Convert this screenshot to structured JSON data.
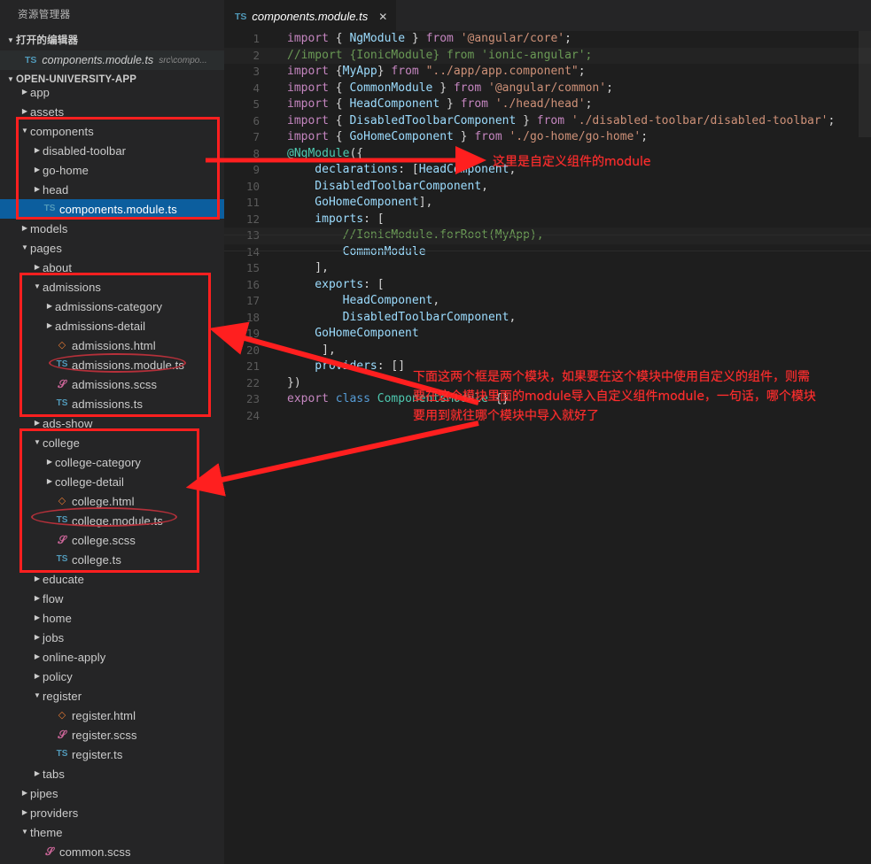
{
  "sidebar": {
    "title": "资源管理器",
    "open_editors": {
      "label": "打开的编辑器",
      "items": [
        {
          "icon": "TS",
          "name": "components.module.ts",
          "path": "src\\compo..."
        }
      ]
    },
    "project": {
      "label": "OPEN-UNIVERSITY-APP"
    },
    "tree": [
      {
        "depth": 1,
        "twisty": "right",
        "icon": "",
        "label": "app",
        "selected": false,
        "clipped": true
      },
      {
        "depth": 1,
        "twisty": "right",
        "icon": "",
        "label": "assets",
        "selected": false
      },
      {
        "depth": 1,
        "twisty": "down",
        "icon": "",
        "label": "components",
        "selected": false
      },
      {
        "depth": 2,
        "twisty": "right",
        "icon": "",
        "label": "disabled-toolbar",
        "selected": false
      },
      {
        "depth": 2,
        "twisty": "right",
        "icon": "",
        "label": "go-home",
        "selected": false
      },
      {
        "depth": 2,
        "twisty": "right",
        "icon": "",
        "label": "head",
        "selected": false
      },
      {
        "depth": 2,
        "twisty": "none",
        "icon": "TS",
        "label": "components.module.ts",
        "selected": true
      },
      {
        "depth": 1,
        "twisty": "right",
        "icon": "",
        "label": "models",
        "selected": false
      },
      {
        "depth": 1,
        "twisty": "down",
        "icon": "",
        "label": "pages",
        "selected": false
      },
      {
        "depth": 2,
        "twisty": "right",
        "icon": "",
        "label": "about",
        "selected": false
      },
      {
        "depth": 2,
        "twisty": "down",
        "icon": "",
        "label": "admissions",
        "selected": false
      },
      {
        "depth": 3,
        "twisty": "right",
        "icon": "",
        "label": "admissions-category",
        "selected": false
      },
      {
        "depth": 3,
        "twisty": "right",
        "icon": "",
        "label": "admissions-detail",
        "selected": false
      },
      {
        "depth": 3,
        "twisty": "none",
        "icon": "HTML",
        "label": "admissions.html",
        "selected": false
      },
      {
        "depth": 3,
        "twisty": "none",
        "icon": "TS",
        "label": "admissions.module.ts",
        "selected": false
      },
      {
        "depth": 3,
        "twisty": "none",
        "icon": "SCSS",
        "label": "admissions.scss",
        "selected": false
      },
      {
        "depth": 3,
        "twisty": "none",
        "icon": "TS",
        "label": "admissions.ts",
        "selected": false
      },
      {
        "depth": 2,
        "twisty": "right",
        "icon": "",
        "label": "ads-show",
        "selected": false
      },
      {
        "depth": 2,
        "twisty": "down",
        "icon": "",
        "label": "college",
        "selected": false
      },
      {
        "depth": 3,
        "twisty": "right",
        "icon": "",
        "label": "college-category",
        "selected": false
      },
      {
        "depth": 3,
        "twisty": "right",
        "icon": "",
        "label": "college-detail",
        "selected": false
      },
      {
        "depth": 3,
        "twisty": "none",
        "icon": "HTML",
        "label": "college.html",
        "selected": false
      },
      {
        "depth": 3,
        "twisty": "none",
        "icon": "TS",
        "label": "college.module.ts",
        "selected": false
      },
      {
        "depth": 3,
        "twisty": "none",
        "icon": "SCSS",
        "label": "college.scss",
        "selected": false
      },
      {
        "depth": 3,
        "twisty": "none",
        "icon": "TS",
        "label": "college.ts",
        "selected": false
      },
      {
        "depth": 2,
        "twisty": "right",
        "icon": "",
        "label": "educate",
        "selected": false
      },
      {
        "depth": 2,
        "twisty": "right",
        "icon": "",
        "label": "flow",
        "selected": false
      },
      {
        "depth": 2,
        "twisty": "right",
        "icon": "",
        "label": "home",
        "selected": false
      },
      {
        "depth": 2,
        "twisty": "right",
        "icon": "",
        "label": "jobs",
        "selected": false
      },
      {
        "depth": 2,
        "twisty": "right",
        "icon": "",
        "label": "online-apply",
        "selected": false
      },
      {
        "depth": 2,
        "twisty": "right",
        "icon": "",
        "label": "policy",
        "selected": false
      },
      {
        "depth": 2,
        "twisty": "down",
        "icon": "",
        "label": "register",
        "selected": false
      },
      {
        "depth": 3,
        "twisty": "none",
        "icon": "HTML",
        "label": "register.html",
        "selected": false
      },
      {
        "depth": 3,
        "twisty": "none",
        "icon": "SCSS",
        "label": "register.scss",
        "selected": false
      },
      {
        "depth": 3,
        "twisty": "none",
        "icon": "TS",
        "label": "register.ts",
        "selected": false
      },
      {
        "depth": 2,
        "twisty": "right",
        "icon": "",
        "label": "tabs",
        "selected": false
      },
      {
        "depth": 1,
        "twisty": "right",
        "icon": "",
        "label": "pipes",
        "selected": false
      },
      {
        "depth": 1,
        "twisty": "right",
        "icon": "",
        "label": "providers",
        "selected": false
      },
      {
        "depth": 1,
        "twisty": "down",
        "icon": "",
        "label": "theme",
        "selected": false
      },
      {
        "depth": 2,
        "twisty": "none",
        "icon": "SCSS",
        "label": "common.scss",
        "selected": false
      }
    ]
  },
  "editor": {
    "tab": {
      "icon": "TS",
      "name": "components.module.ts",
      "close": "✕"
    },
    "lines": [
      {
        "n": "1",
        "cursor": false,
        "tokens": [
          {
            "t": "import ",
            "c": "k"
          },
          {
            "t": "{ ",
            "c": "pn"
          },
          {
            "t": "NgModule",
            "c": "id"
          },
          {
            "t": " } ",
            "c": "pn"
          },
          {
            "t": "from ",
            "c": "k"
          },
          {
            "t": "'@angular/core'",
            "c": "st"
          },
          {
            "t": ";",
            "c": "pn"
          }
        ]
      },
      {
        "n": "2",
        "cursor": true,
        "tokens": [
          {
            "t": "//import {IonicModule} from 'ionic-angular';",
            "c": "cm"
          }
        ]
      },
      {
        "n": "3",
        "cursor": false,
        "tokens": [
          {
            "t": "import ",
            "c": "k"
          },
          {
            "t": "{",
            "c": "pn"
          },
          {
            "t": "MyApp",
            "c": "id"
          },
          {
            "t": "} ",
            "c": "pn"
          },
          {
            "t": "from ",
            "c": "k"
          },
          {
            "t": "\"../app/app.component\"",
            "c": "st"
          },
          {
            "t": ";",
            "c": "pn"
          }
        ]
      },
      {
        "n": "4",
        "cursor": false,
        "tokens": [
          {
            "t": "import ",
            "c": "k"
          },
          {
            "t": "{ ",
            "c": "pn"
          },
          {
            "t": "CommonModule",
            "c": "id"
          },
          {
            "t": " } ",
            "c": "pn"
          },
          {
            "t": "from ",
            "c": "k"
          },
          {
            "t": "'@angular/common'",
            "c": "st"
          },
          {
            "t": ";",
            "c": "pn"
          }
        ]
      },
      {
        "n": "5",
        "cursor": false,
        "tokens": [
          {
            "t": "import ",
            "c": "k"
          },
          {
            "t": "{ ",
            "c": "pn"
          },
          {
            "t": "HeadComponent",
            "c": "id"
          },
          {
            "t": " } ",
            "c": "pn"
          },
          {
            "t": "from ",
            "c": "k"
          },
          {
            "t": "'./head/head'",
            "c": "st"
          },
          {
            "t": ";",
            "c": "pn"
          }
        ]
      },
      {
        "n": "6",
        "cursor": false,
        "tokens": [
          {
            "t": "import ",
            "c": "k"
          },
          {
            "t": "{ ",
            "c": "pn"
          },
          {
            "t": "DisabledToolbarComponent",
            "c": "id"
          },
          {
            "t": " } ",
            "c": "pn"
          },
          {
            "t": "from ",
            "c": "k"
          },
          {
            "t": "'./disabled-toolbar/disabled-toolbar'",
            "c": "st"
          },
          {
            "t": ";",
            "c": "pn"
          }
        ]
      },
      {
        "n": "7",
        "cursor": false,
        "tokens": [
          {
            "t": "import ",
            "c": "k"
          },
          {
            "t": "{ ",
            "c": "pn"
          },
          {
            "t": "GoHomeComponent",
            "c": "id"
          },
          {
            "t": " } ",
            "c": "pn"
          },
          {
            "t": "from ",
            "c": "k"
          },
          {
            "t": "'./go-home/go-home'",
            "c": "st"
          },
          {
            "t": ";",
            "c": "pn"
          }
        ]
      },
      {
        "n": "8",
        "cursor": false,
        "tokens": [
          {
            "t": "@NgModule",
            "c": "ty"
          },
          {
            "t": "({",
            "c": "pn"
          }
        ]
      },
      {
        "n": "9",
        "cursor": false,
        "tokens": [
          {
            "t": "    declarations",
            "c": "id"
          },
          {
            "t": ": [",
            "c": "pn"
          },
          {
            "t": "HeadComponent",
            "c": "id"
          },
          {
            "t": ",",
            "c": "pn"
          }
        ]
      },
      {
        "n": "10",
        "cursor": false,
        "tokens": [
          {
            "t": "    DisabledToolbarComponent",
            "c": "id"
          },
          {
            "t": ",",
            "c": "pn"
          }
        ]
      },
      {
        "n": "11",
        "cursor": false,
        "tokens": [
          {
            "t": "    GoHomeComponent",
            "c": "id"
          },
          {
            "t": "],",
            "c": "pn"
          }
        ]
      },
      {
        "n": "12",
        "cursor": false,
        "tokens": [
          {
            "t": "    imports",
            "c": "id"
          },
          {
            "t": ": [",
            "c": "pn"
          }
        ]
      },
      {
        "n": "13",
        "cursor": true,
        "tokens": [
          {
            "t": "        //IonicModule.forRoot(MyApp),",
            "c": "cm"
          }
        ]
      },
      {
        "n": "14",
        "cursor": false,
        "tokens": [
          {
            "t": "        CommonModule",
            "c": "id"
          }
        ]
      },
      {
        "n": "15",
        "cursor": false,
        "tokens": [
          {
            "t": "    ],",
            "c": "pn"
          }
        ]
      },
      {
        "n": "16",
        "cursor": false,
        "tokens": [
          {
            "t": "    exports",
            "c": "id"
          },
          {
            "t": ": [",
            "c": "pn"
          }
        ]
      },
      {
        "n": "17",
        "cursor": false,
        "tokens": [
          {
            "t": "        HeadComponent",
            "c": "id"
          },
          {
            "t": ",",
            "c": "pn"
          }
        ]
      },
      {
        "n": "18",
        "cursor": false,
        "tokens": [
          {
            "t": "        DisabledToolbarComponent",
            "c": "id"
          },
          {
            "t": ",",
            "c": "pn"
          }
        ]
      },
      {
        "n": "19",
        "cursor": false,
        "tokens": [
          {
            "t": "    GoHomeComponent",
            "c": "id"
          }
        ]
      },
      {
        "n": "20",
        "cursor": false,
        "tokens": [
          {
            "t": "     ],",
            "c": "pn"
          }
        ]
      },
      {
        "n": "21",
        "cursor": false,
        "tokens": [
          {
            "t": "    providers",
            "c": "id"
          },
          {
            "t": ": []",
            "c": "pn"
          }
        ]
      },
      {
        "n": "22",
        "cursor": false,
        "tokens": [
          {
            "t": "})",
            "c": "pn"
          }
        ]
      },
      {
        "n": "23",
        "cursor": false,
        "tokens": [
          {
            "t": "export ",
            "c": "k"
          },
          {
            "t": "class ",
            "c": "kw"
          },
          {
            "t": "ComponentsModule",
            "c": "ty"
          },
          {
            "t": " {}",
            "c": "pn"
          }
        ]
      },
      {
        "n": "24",
        "cursor": false,
        "tokens": []
      }
    ]
  },
  "annotations": {
    "note_components": "这里是自定义组件的module",
    "note_modules": "下面这两个框是两个模块，如果要在这个模块中使用自定义的组件，则需\n要在这个模块里面的module导入自定义组件module，一句话，哪个模块\n要用到就往哪个模块中导入就好了",
    "accent_color": "#ff1f1f",
    "text_color": "#ff2d2d",
    "ellipse_color": "#b5303a"
  }
}
